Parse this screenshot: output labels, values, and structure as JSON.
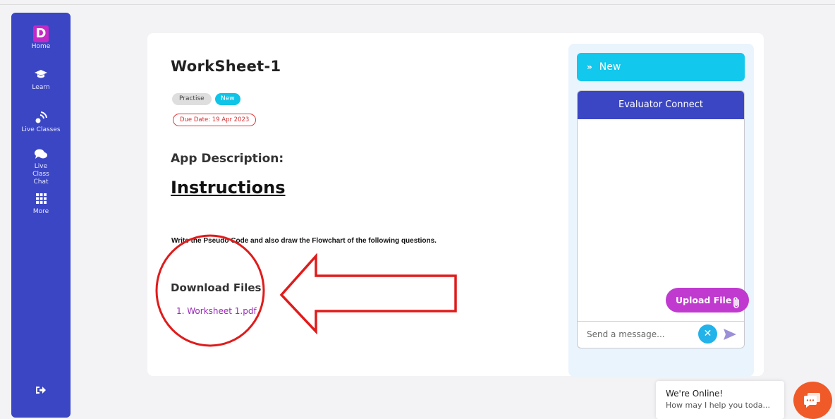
{
  "sidebar": {
    "logo_letter": "D",
    "items": [
      {
        "label": "Home"
      },
      {
        "label": "Learn"
      },
      {
        "label": "Live Classes"
      },
      {
        "label": "Live Class Chat"
      },
      {
        "label": "More"
      }
    ]
  },
  "worksheet": {
    "title": "WorkSheet-1",
    "tags": [
      "Practise",
      "New"
    ],
    "due_date": "Due Date: 19 Apr 2023",
    "app_description_heading": "App Description:",
    "instructions_heading": "Instructions",
    "instructions_text": "Write the Pseudo Code and also draw the Flowchart of the following questions.",
    "download_heading": "Download Files",
    "files": [
      "1. Worksheet 1.pdf"
    ]
  },
  "panel": {
    "new_button": "New",
    "chat_title": "Evaluator Connect",
    "message_placeholder": "Send a message...",
    "upload_button": "Upload File"
  },
  "chat_widget": {
    "title": "We're Online!",
    "subtitle": "How may I help you toda..."
  },
  "colors": {
    "sidebar": "#3b46c4",
    "accent_cyan": "#12c8ec",
    "upload": "#c03ad0",
    "annotation": "#e01b1b",
    "chat_bubble": "#f05a28"
  }
}
